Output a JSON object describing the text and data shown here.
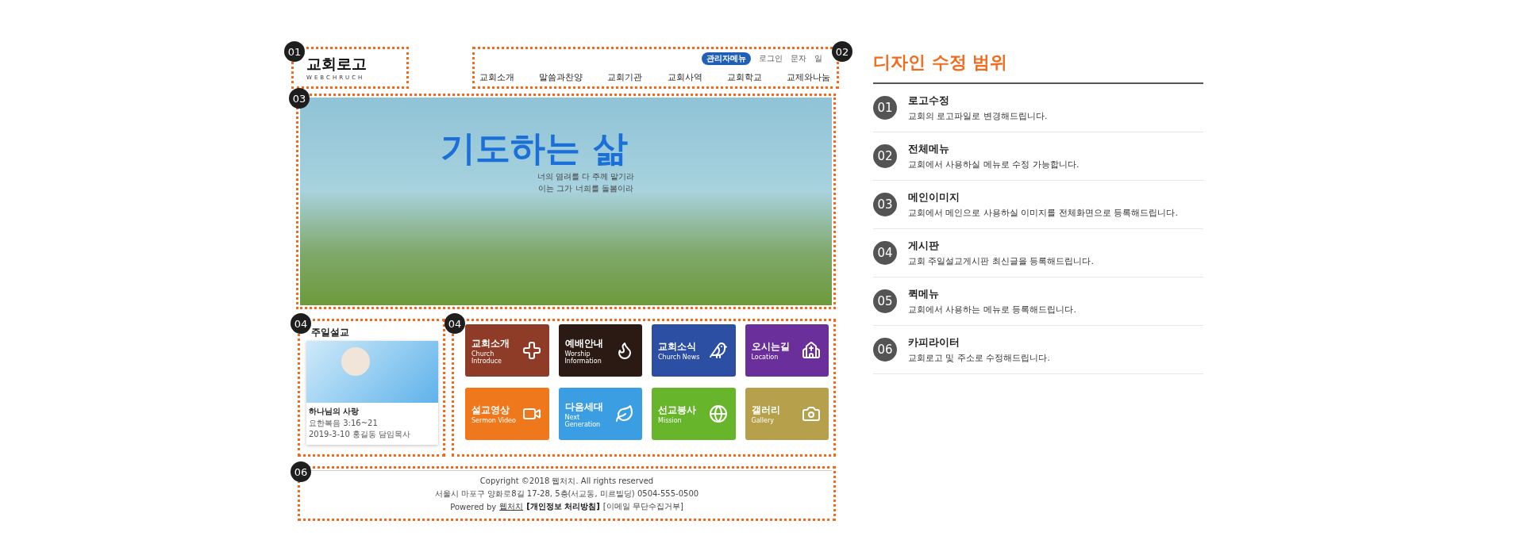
{
  "header": {
    "logo": {
      "title": "교회로고",
      "subtitle": "WEBCHRUCH",
      "marker": "01"
    },
    "nav": {
      "marker": "02",
      "admin_badge": "관리자메뉴",
      "top_links": [
        "로그인",
        "문자",
        "일"
      ],
      "items": [
        "교회소개",
        "말씀과찬양",
        "교회기관",
        "교회사역",
        "교회학교",
        "교제와나눔"
      ]
    }
  },
  "banner": {
    "marker": "03",
    "title": "기도하는 삶",
    "lines": [
      "너의 염려를 다 주께 맡기라",
      "이는 그가 너희를 돌봄이라"
    ]
  },
  "sermon": {
    "marker": "04",
    "heading": "주일설교",
    "title": "하나님의 사랑",
    "verse": "요한복음 3:16~21",
    "meta": "2019-3-10 홍길동 담임목사"
  },
  "tiles": {
    "marker": "04",
    "items": [
      {
        "title": "교회소개",
        "subtitle": "Church Introduce",
        "color": "#8e3b27"
      },
      {
        "title": "예배안내",
        "subtitle": "Worship Information",
        "color": "#2b1a14"
      },
      {
        "title": "교회소식",
        "subtitle": "Church News",
        "color": "#2c4fa3"
      },
      {
        "title": "오시는길",
        "subtitle": "Location",
        "color": "#6a2f9b"
      },
      {
        "title": "설교영상",
        "subtitle": "Sermon Video",
        "color": "#f0781c"
      },
      {
        "title": "다음세대",
        "subtitle": "Next Generation",
        "color": "#3c9ee2"
      },
      {
        "title": "선교봉사",
        "subtitle": "Mission",
        "color": "#67b52a"
      },
      {
        "title": "갤러리",
        "subtitle": "Gallery",
        "color": "#b6a04c"
      }
    ]
  },
  "footer": {
    "marker": "06",
    "copyright": "Copyright ©2018 웹처치. All rights reserved",
    "address": "서울시 마포구 양화로8길 17-28, 5층(서교동, 미르빌딩)  0504-555-0500",
    "powered_prefix": "Powered by",
    "powered_link": "웹처치",
    "privacy": "[개인정보 처리방침]",
    "no_email": "[이메일 무단수집거부]"
  },
  "scope": {
    "title": "디자인 수정 범위",
    "items": [
      {
        "number": "01",
        "title": "로고수정",
        "description": "교회의 로고파일로 변경해드립니다."
      },
      {
        "number": "02",
        "title": "전체메뉴",
        "description": "교회에서 사용하실 메뉴로 수정 가능합니다."
      },
      {
        "number": "03",
        "title": "메인이미지",
        "description": "교회에서 메인으로 사용하실 이미지를 전체화면으로 등록해드립니다."
      },
      {
        "number": "04",
        "title": "게시판",
        "description": "교회 주일설교게시판 최신글을 등록해드립니다."
      },
      {
        "number": "05",
        "title": "퀵메뉴",
        "description": "교회에서 사용하는 메뉴로 등록해드립니다."
      },
      {
        "number": "06",
        "title": "카피라이터",
        "description": "교회로고 및 주소로 수정해드립니다."
      }
    ]
  }
}
